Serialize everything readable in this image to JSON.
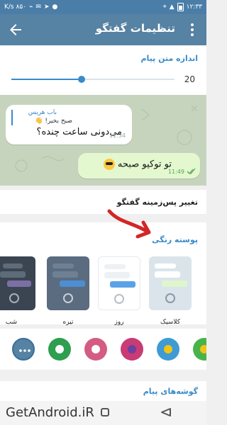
{
  "status_bar": {
    "time": "۱۲:۳۳",
    "network_speed": "K/s ۸۵۰"
  },
  "app_bar": {
    "title": "تنظیمات گفتگو",
    "back_icon": "arrow-left-icon",
    "menu_icon": "more-vertical-icon"
  },
  "text_size": {
    "header": "اندازه متن پیام",
    "value": "20",
    "slider_fraction": 0.43
  },
  "preview": {
    "reply_name": "باب هریس",
    "reply_text": "صبح بخیر! 👋",
    "incoming_text": "می‌دونی ساعت چنده؟",
    "incoming_time": "11:34",
    "outgoing_text": "تو توکیو صبحه",
    "outgoing_time": "11:49"
  },
  "change_background": {
    "label": "تغییر پس‌زمینه گفتگو"
  },
  "color_theme": {
    "header": "پوسته رنگی",
    "themes": [
      {
        "label": "شب",
        "selected": false
      },
      {
        "label": "تیره",
        "selected": false
      },
      {
        "label": "روز",
        "selected": false
      },
      {
        "label": "کلاسیک",
        "selected": true
      }
    ]
  },
  "accent_colors": {
    "items": [
      "#2f6fa6",
      "#2e9e4f",
      "#d45b82",
      "#c83b74",
      "#3f9bd2",
      "#49b34a"
    ]
  },
  "message_corners": {
    "header": "گوشه‌های پیام"
  },
  "nav_bar": {
    "watermark": "GetAndroid.iR"
  },
  "colors": {
    "header_blue": "#5682a3",
    "accent": "#3a8bc8",
    "annotation_red": "#d32626"
  }
}
